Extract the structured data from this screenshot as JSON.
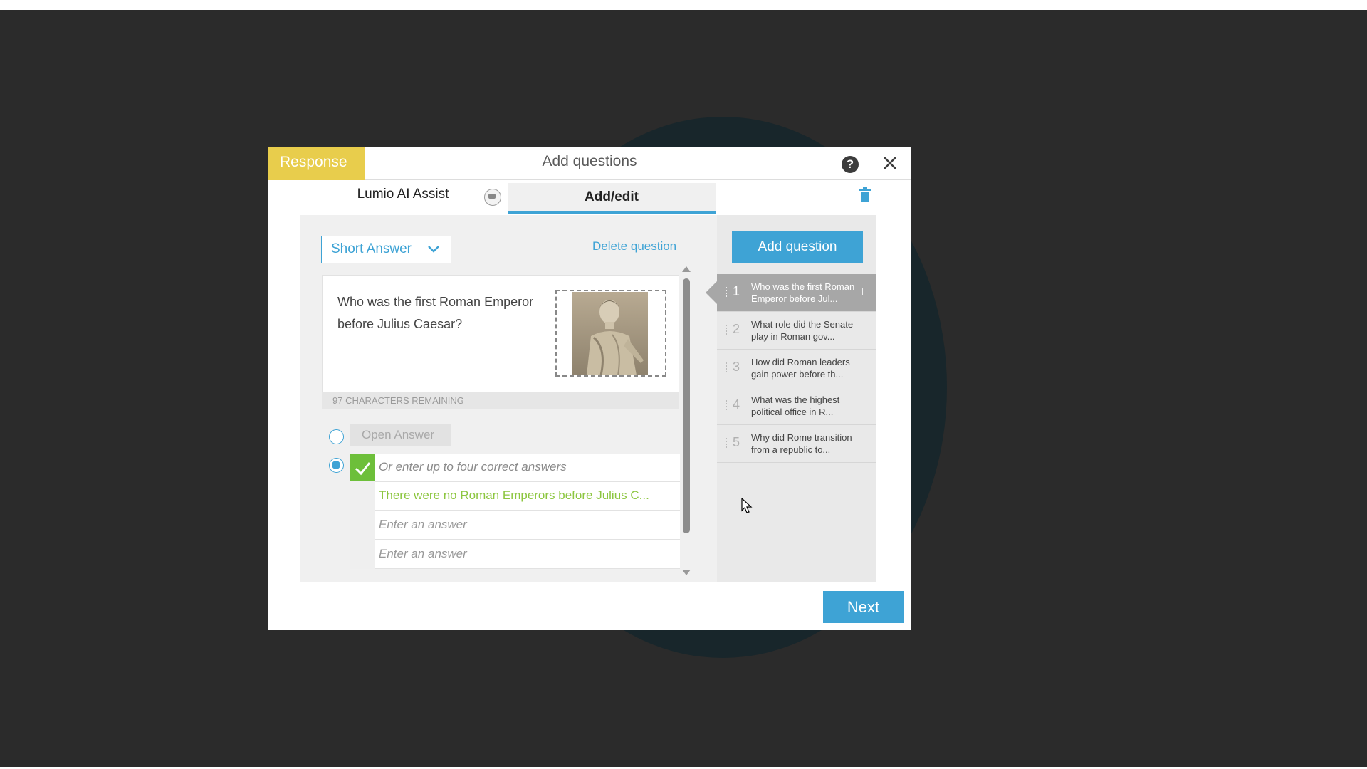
{
  "dialog": {
    "response_label": "Response",
    "title": "Add questions",
    "help_glyph": "?"
  },
  "tabs": {
    "ai_assist": "Lumio AI Assist",
    "add_edit": "Add/edit"
  },
  "toolbar": {
    "question_type": "Short Answer",
    "delete_question": "Delete question",
    "add_question": "Add question"
  },
  "question": {
    "text": "Who was the first Roman Emperor before Julius Caesar?",
    "chars_remaining": "97 CHARACTERS REMAINING"
  },
  "answers": {
    "open_answer": "Open Answer",
    "header": "Or enter up to four correct answers",
    "rows": [
      "There were no Roman Emperors before Julius C...",
      "Enter an answer",
      "Enter an answer"
    ]
  },
  "question_list": [
    {
      "num": "1",
      "text": "Who was the first Roman Emperor before Jul..."
    },
    {
      "num": "2",
      "text": "What role did the Senate play in Roman gov..."
    },
    {
      "num": "3",
      "text": "How did Roman leaders gain power before th..."
    },
    {
      "num": "4",
      "text": "What was the highest political office in R..."
    },
    {
      "num": "5",
      "text": "Why did Rome transition from a republic to..."
    }
  ],
  "footer": {
    "next": "Next"
  },
  "icons": {
    "help": "help-icon",
    "close": "close-icon",
    "trash": "trash-icon",
    "chevron": "chevron-down-icon",
    "check": "check-icon",
    "image": "image-icon",
    "cursor": "cursor-icon"
  },
  "colors": {
    "accent": "#3ea3d5",
    "response_tab": "#e8cd4c",
    "correct": "#8cc63f",
    "check_bg": "#6dbf3a",
    "active_item": "#a7a7a7",
    "backdrop": "#2b2b2b"
  }
}
